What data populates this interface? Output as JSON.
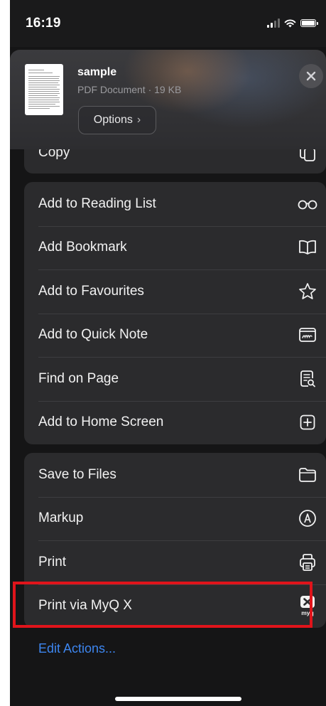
{
  "status_bar": {
    "time": "16:19",
    "icons": [
      "cellular-signal-icon",
      "wifi-icon",
      "battery-icon"
    ]
  },
  "share_header": {
    "title": "sample",
    "subtitle": "PDF Document · 19 KB",
    "options_label": "Options",
    "options_chevron": "›",
    "close_icon": "xmark-icon"
  },
  "copy_row": {
    "label": "Copy",
    "icon": "copy-icon"
  },
  "group_one": [
    {
      "label": "Add to Reading List",
      "icon": "glasses-icon"
    },
    {
      "label": "Add Bookmark",
      "icon": "book-icon"
    },
    {
      "label": "Add to Favourites",
      "icon": "star-icon"
    },
    {
      "label": "Add to Quick Note",
      "icon": "quick-note-icon"
    },
    {
      "label": "Find on Page",
      "icon": "find-on-page-icon"
    },
    {
      "label": "Add to Home Screen",
      "icon": "plus-square-icon"
    }
  ],
  "group_two": [
    {
      "label": "Save to Files",
      "icon": "folder-icon"
    },
    {
      "label": "Markup",
      "icon": "markup-pen-icon"
    },
    {
      "label": "Print",
      "icon": "printer-icon"
    },
    {
      "label": "Print via MyQ X",
      "icon": "myq-app-icon",
      "icon_text": "myq"
    }
  ],
  "edit_actions_label": "Edit Actions...",
  "colors": {
    "background": "#151516",
    "group_background": "#2b2b2d",
    "separator": "#3d3d40",
    "text_primary": "#f2f2f2",
    "text_secondary": "#9a9a9e",
    "link": "#3d86f0",
    "highlight_border": "#e0141b"
  }
}
